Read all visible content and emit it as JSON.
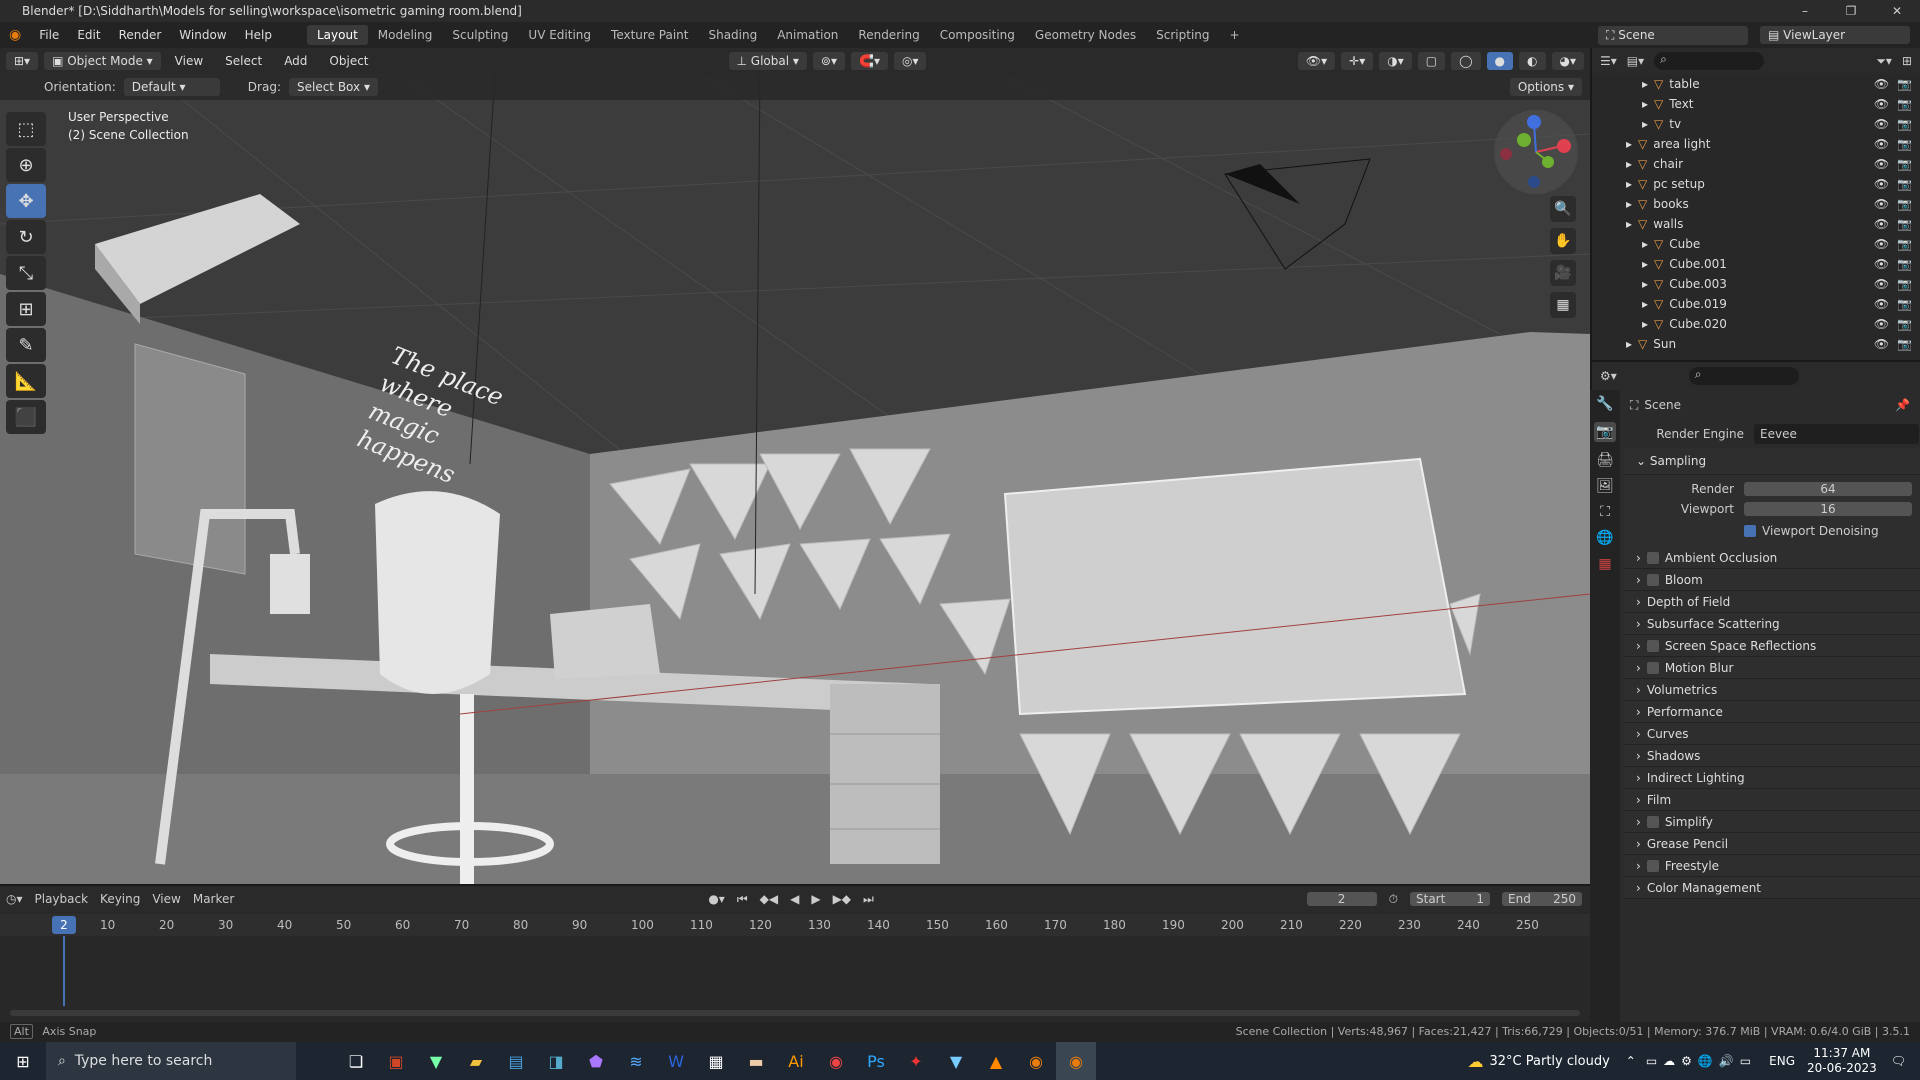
{
  "window": {
    "title": "Blender* [D:\\Siddharth\\Models for selling\\workspace\\isometric gaming room.blend]",
    "minimize": "–",
    "maximize": "❐",
    "close": "✕"
  },
  "menu": {
    "items": [
      "File",
      "Edit",
      "Render",
      "Window",
      "Help"
    ]
  },
  "workspaces": [
    "Layout",
    "Modeling",
    "Sculpting",
    "UV Editing",
    "Texture Paint",
    "Shading",
    "Animation",
    "Rendering",
    "Compositing",
    "Geometry Nodes",
    "Scripting"
  ],
  "scene_selector": "Scene",
  "viewlayer_selector": "ViewLayer",
  "viewport_header": {
    "mode": "Object Mode",
    "view": "View",
    "select": "Select",
    "add": "Add",
    "object": "Object",
    "transform": "Global",
    "options": "Options"
  },
  "tool_settings": {
    "orientation_label": "Orientation:",
    "orientation_value": "Default",
    "drag_label": "Drag:",
    "drag_value": "Select Box"
  },
  "viewport_info": {
    "line1": "User Perspective",
    "line2": "(2) Scene Collection"
  },
  "wall_text": "The place where magic happens",
  "outliner": {
    "items": [
      {
        "name": "table",
        "indent": 2
      },
      {
        "name": "Text",
        "indent": 2
      },
      {
        "name": "tv",
        "indent": 2
      },
      {
        "name": "area light",
        "indent": 1
      },
      {
        "name": "chair",
        "indent": 1
      },
      {
        "name": "pc setup",
        "indent": 1
      },
      {
        "name": "books",
        "indent": 1
      },
      {
        "name": "walls",
        "indent": 1
      },
      {
        "name": "Cube",
        "indent": 2
      },
      {
        "name": "Cube.001",
        "indent": 2
      },
      {
        "name": "Cube.003",
        "indent": 2
      },
      {
        "name": "Cube.019",
        "indent": 2
      },
      {
        "name": "Cube.020",
        "indent": 2
      },
      {
        "name": "Sun",
        "indent": 1
      }
    ]
  },
  "properties": {
    "context": "Scene",
    "render_engine_label": "Render Engine",
    "render_engine": "Eevee",
    "sampling": {
      "title": "Sampling",
      "render_label": "Render",
      "render_value": "64",
      "viewport_label": "Viewport",
      "viewport_value": "16",
      "denoise": "Viewport Denoising"
    },
    "panels": [
      {
        "name": "Ambient Occlusion",
        "checkbox": true
      },
      {
        "name": "Bloom",
        "checkbox": true
      },
      {
        "name": "Depth of Field",
        "checkbox": false
      },
      {
        "name": "Subsurface Scattering",
        "checkbox": false
      },
      {
        "name": "Screen Space Reflections",
        "checkbox": true
      },
      {
        "name": "Motion Blur",
        "checkbox": true
      },
      {
        "name": "Volumetrics",
        "checkbox": false
      },
      {
        "name": "Performance",
        "checkbox": false
      },
      {
        "name": "Curves",
        "checkbox": false
      },
      {
        "name": "Shadows",
        "checkbox": false
      },
      {
        "name": "Indirect Lighting",
        "checkbox": false
      },
      {
        "name": "Film",
        "checkbox": false
      },
      {
        "name": "Simplify",
        "checkbox": true
      },
      {
        "name": "Grease Pencil",
        "checkbox": false
      },
      {
        "name": "Freestyle",
        "checkbox": true
      },
      {
        "name": "Color Management",
        "checkbox": false
      }
    ]
  },
  "timeline": {
    "playback": "Playback",
    "keying": "Keying",
    "view": "View",
    "marker": "Marker",
    "current_frame": "2",
    "start_label": "Start",
    "start": "1",
    "end_label": "End",
    "end": "250",
    "ticks": [
      "10",
      "20",
      "30",
      "40",
      "50",
      "60",
      "70",
      "80",
      "90",
      "100",
      "110",
      "120",
      "130",
      "140",
      "150",
      "160",
      "170",
      "180",
      "190",
      "200",
      "210",
      "220",
      "230",
      "240",
      "250"
    ]
  },
  "status": {
    "left": "Axis Snap",
    "right": "Scene Collection | Verts:48,967 | Faces:21,427 | Tris:66,729 | Objects:0/51 | Memory: 376.7 MiB | VRAM: 0.6/4.0 GiB | 3.5.1",
    "alt": "Alt"
  },
  "taskbar": {
    "search_placeholder": "Type here to search",
    "weather": "32°C  Partly cloudy",
    "lang": "ENG",
    "time": "11:37 AM",
    "date": "20-06-2023"
  },
  "colors": {
    "accent": "#4772b3",
    "viewport_bg": "#3c3c3c"
  }
}
